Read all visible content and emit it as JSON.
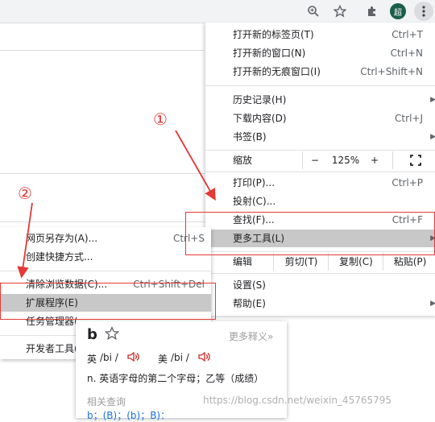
{
  "toolbar": {
    "icons": [
      "zoom-icon",
      "star-icon",
      "puzzle-icon",
      "avatar",
      "kebab-menu-icon"
    ],
    "avatar_text": "超"
  },
  "main_menu": {
    "new_tab": {
      "label": "打开新的标签页(T)",
      "shortcut": "Ctrl+T"
    },
    "new_window": {
      "label": "打开新的窗口(N)",
      "shortcut": "Ctrl+N"
    },
    "new_incognito": {
      "label": "打开新的无痕窗口(I)",
      "shortcut": "Ctrl+Shift+N"
    },
    "history": {
      "label": "历史记录(H)"
    },
    "downloads": {
      "label": "下载内容(D)",
      "shortcut": "Ctrl+J"
    },
    "bookmarks": {
      "label": "书签(B)"
    },
    "zoom": {
      "label": "缩放",
      "minus": "−",
      "value": "125%",
      "plus": "+"
    },
    "print": {
      "label": "打印(P)...",
      "shortcut": "Ctrl+P"
    },
    "cast": {
      "label": "投射(C)..."
    },
    "find": {
      "label": "查找(F)...",
      "shortcut": "Ctrl+F"
    },
    "more_tools": {
      "label": "更多工具(L)"
    },
    "edit": {
      "label": "编辑",
      "cut": "剪切(T)",
      "copy": "复制(C)",
      "paste": "粘贴(P)"
    },
    "settings": {
      "label": "设置(S)"
    },
    "help": {
      "label": "帮助(E)"
    }
  },
  "sub_menu": {
    "save_page": {
      "label": "网页另存为(A)...",
      "shortcut": "Ctrl+S"
    },
    "create_shortcut": {
      "label": "创建快捷方式..."
    },
    "clear_data": {
      "label": "清除浏览数据(C)...",
      "shortcut": "Ctrl+Shift+Del"
    },
    "extensions": {
      "label": "扩展程序(E)"
    },
    "task_manager": {
      "label": "任务管理器("
    },
    "dev_tools": {
      "label": "开发者工具("
    }
  },
  "dict": {
    "word": "b",
    "more": "更多释义»",
    "uk_label": "英",
    "uk_phon": "/bi /",
    "us_label": "美",
    "us_phon": "/bi /",
    "definition": "n. 英语字母的第二个字母；乙等（成绩）",
    "related_title": "相关查询",
    "related": "b；(B)；(b)；B)："
  },
  "annotations": {
    "one": "①",
    "two": "②"
  },
  "watermark": "https://blog.csdn.net/weixin_45765795",
  "colors": {
    "highlight": "#c8c8c8",
    "annotation": "#e53935",
    "speaker": "#c62828",
    "link": "#1a73e8"
  }
}
